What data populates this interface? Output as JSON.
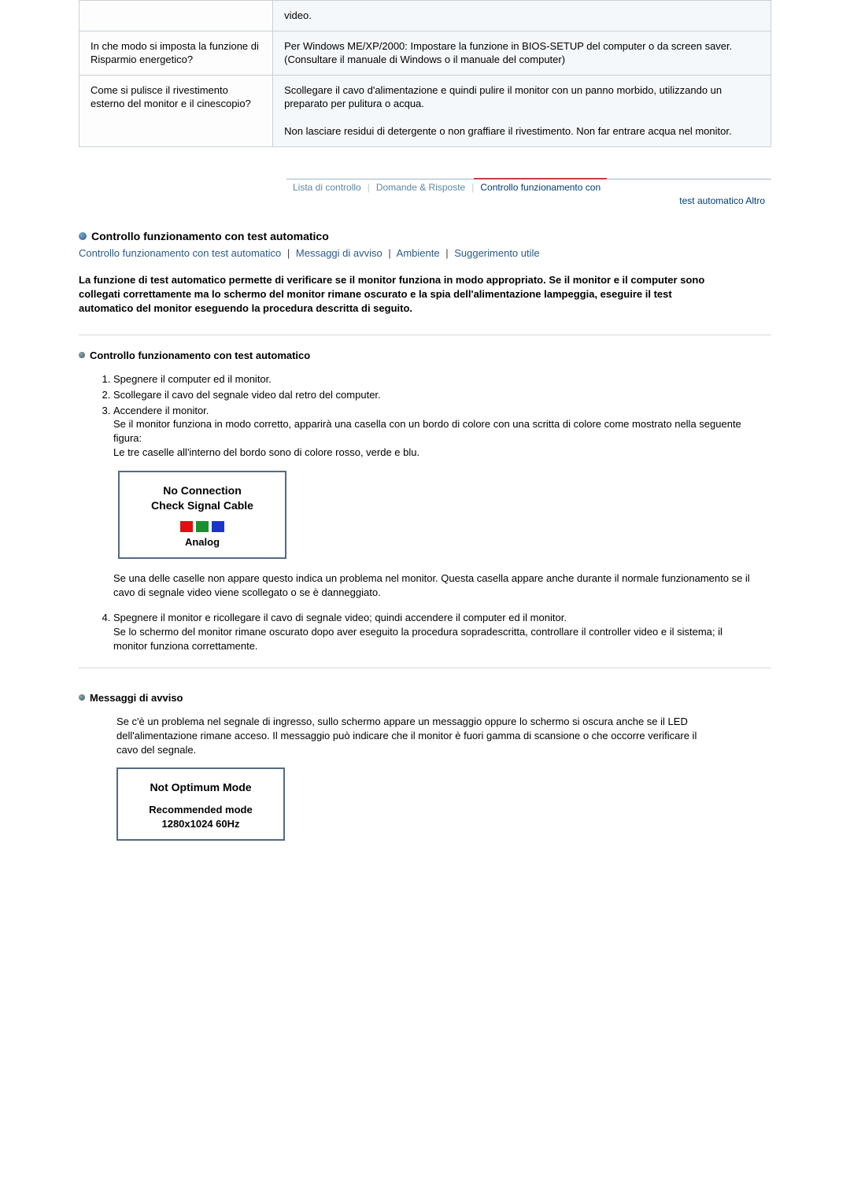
{
  "faq_rows": [
    {
      "q": "",
      "a": "video."
    },
    {
      "q": "In che modo si imposta la funzione di Risparmio energetico?",
      "a": "Per Windows ME/XP/2000: Impostare la funzione in BIOS-SETUP del computer o da screen saver. (Consultare il manuale di Windows o il manuale del computer)"
    },
    {
      "q": "Come si pulisce il rivestimento esterno del monitor e il cinescopio?",
      "a": "Scollegare il cavo d'alimentazione e quindi pulire il monitor con un panno morbido, utilizzando un preparato per pulitura o acqua.\n\nNon lasciare residui di detergente o non graffiare il rivestimento. Non far entrare acqua nel monitor."
    }
  ],
  "tabs": {
    "items": [
      "Lista di controllo",
      "Domande & Risposte",
      "Controllo funzionamento con"
    ],
    "subline": "test automatico Altro"
  },
  "section": {
    "title": "Controllo funzionamento con test automatico",
    "links": [
      "Controllo funzionamento con test automatico",
      "Messaggi di avviso",
      "Ambiente",
      "Suggerimento utile"
    ],
    "intro": "La funzione di test automatico permette di verificare se il monitor funziona in modo appropriato. Se il monitor e il computer sono collegati correttamente ma lo schermo del monitor rimane oscurato e la spia dell'alimentazione lampeggia, eseguire il test automatico del monitor eseguendo la procedura descritta di seguito."
  },
  "selftest": {
    "heading": "Controllo funzionamento con test automatico",
    "steps": {
      "s1": "Spegnere il computer ed il monitor.",
      "s2": "Scollegare il cavo del segnale video dal retro del computer.",
      "s3_line1": "Accendere il monitor.",
      "s3_line2": "Se il monitor funziona in modo corretto, apparirà una casella con un bordo di colore con una scritta di colore come mostrato nella seguente figura:",
      "s3_line3": "Le tre caselle all'interno del bordo sono di colore rosso, verde e blu.",
      "s3_after": "Se una delle caselle non appare questo indica un problema nel monitor. Questa casella appare anche durante il normale funzionamento se il cavo di segnale video viene scollegato o se è danneggiato.",
      "s4_line1": "Spegnere il monitor e ricollegare il cavo di segnale video; quindi accendere il computer ed il monitor.",
      "s4_line2": "Se lo schermo del monitor rimane oscurato dopo aver eseguito la procedura sopradescritta, controllare il controller video e il sistema; il monitor funziona correttamente."
    },
    "dialog": {
      "line1": "No Connection",
      "line2": "Check Signal Cable",
      "sub": "Analog"
    }
  },
  "warnings": {
    "heading": "Messaggi di avviso",
    "body": "Se c'è un problema nel segnale di ingresso, sullo schermo appare un messaggio oppure lo schermo si oscura anche se il LED dell'alimentazione rimane acceso. Il messaggio può indicare che il monitor è fuori gamma di scansione o che occorre verificare il cavo del segnale.",
    "dialog": {
      "line1": "Not Optimum Mode",
      "line2": "Recommended mode",
      "line3": "1280x1024    60Hz"
    }
  }
}
